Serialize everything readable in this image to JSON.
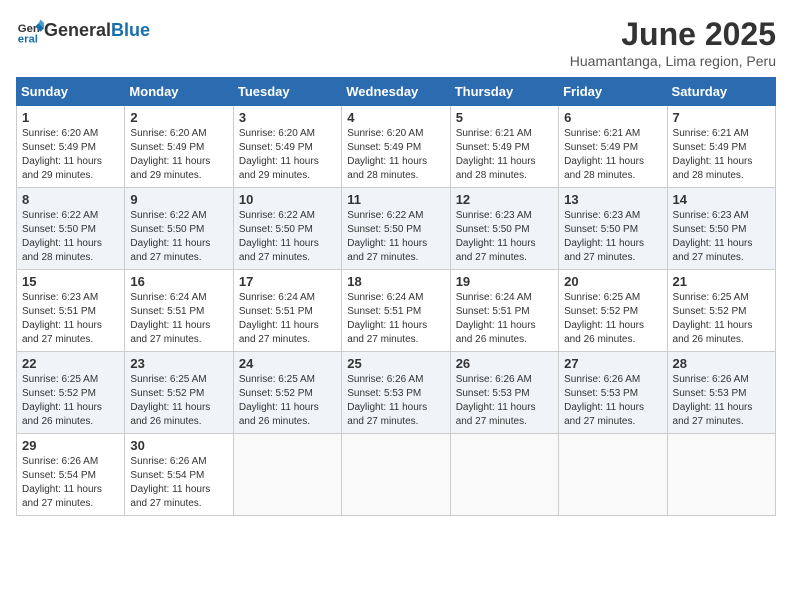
{
  "header": {
    "logo_general": "General",
    "logo_blue": "Blue",
    "title": "June 2025",
    "subtitle": "Huamantanga, Lima region, Peru"
  },
  "calendar": {
    "headers": [
      "Sunday",
      "Monday",
      "Tuesday",
      "Wednesday",
      "Thursday",
      "Friday",
      "Saturday"
    ],
    "weeks": [
      [
        {
          "day": "",
          "sunrise": "",
          "sunset": "",
          "daylight": ""
        },
        {
          "day": "2",
          "sunrise": "Sunrise: 6:20 AM",
          "sunset": "Sunset: 5:49 PM",
          "daylight": "Daylight: 11 hours and 29 minutes."
        },
        {
          "day": "3",
          "sunrise": "Sunrise: 6:20 AM",
          "sunset": "Sunset: 5:49 PM",
          "daylight": "Daylight: 11 hours and 29 minutes."
        },
        {
          "day": "4",
          "sunrise": "Sunrise: 6:20 AM",
          "sunset": "Sunset: 5:49 PM",
          "daylight": "Daylight: 11 hours and 28 minutes."
        },
        {
          "day": "5",
          "sunrise": "Sunrise: 6:21 AM",
          "sunset": "Sunset: 5:49 PM",
          "daylight": "Daylight: 11 hours and 28 minutes."
        },
        {
          "day": "6",
          "sunrise": "Sunrise: 6:21 AM",
          "sunset": "Sunset: 5:49 PM",
          "daylight": "Daylight: 11 hours and 28 minutes."
        },
        {
          "day": "7",
          "sunrise": "Sunrise: 6:21 AM",
          "sunset": "Sunset: 5:49 PM",
          "daylight": "Daylight: 11 hours and 28 minutes."
        }
      ],
      [
        {
          "day": "8",
          "sunrise": "Sunrise: 6:22 AM",
          "sunset": "Sunset: 5:50 PM",
          "daylight": "Daylight: 11 hours and 28 minutes."
        },
        {
          "day": "9",
          "sunrise": "Sunrise: 6:22 AM",
          "sunset": "Sunset: 5:50 PM",
          "daylight": "Daylight: 11 hours and 27 minutes."
        },
        {
          "day": "10",
          "sunrise": "Sunrise: 6:22 AM",
          "sunset": "Sunset: 5:50 PM",
          "daylight": "Daylight: 11 hours and 27 minutes."
        },
        {
          "day": "11",
          "sunrise": "Sunrise: 6:22 AM",
          "sunset": "Sunset: 5:50 PM",
          "daylight": "Daylight: 11 hours and 27 minutes."
        },
        {
          "day": "12",
          "sunrise": "Sunrise: 6:23 AM",
          "sunset": "Sunset: 5:50 PM",
          "daylight": "Daylight: 11 hours and 27 minutes."
        },
        {
          "day": "13",
          "sunrise": "Sunrise: 6:23 AM",
          "sunset": "Sunset: 5:50 PM",
          "daylight": "Daylight: 11 hours and 27 minutes."
        },
        {
          "day": "14",
          "sunrise": "Sunrise: 6:23 AM",
          "sunset": "Sunset: 5:50 PM",
          "daylight": "Daylight: 11 hours and 27 minutes."
        }
      ],
      [
        {
          "day": "15",
          "sunrise": "Sunrise: 6:23 AM",
          "sunset": "Sunset: 5:51 PM",
          "daylight": "Daylight: 11 hours and 27 minutes."
        },
        {
          "day": "16",
          "sunrise": "Sunrise: 6:24 AM",
          "sunset": "Sunset: 5:51 PM",
          "daylight": "Daylight: 11 hours and 27 minutes."
        },
        {
          "day": "17",
          "sunrise": "Sunrise: 6:24 AM",
          "sunset": "Sunset: 5:51 PM",
          "daylight": "Daylight: 11 hours and 27 minutes."
        },
        {
          "day": "18",
          "sunrise": "Sunrise: 6:24 AM",
          "sunset": "Sunset: 5:51 PM",
          "daylight": "Daylight: 11 hours and 27 minutes."
        },
        {
          "day": "19",
          "sunrise": "Sunrise: 6:24 AM",
          "sunset": "Sunset: 5:51 PM",
          "daylight": "Daylight: 11 hours and 26 minutes."
        },
        {
          "day": "20",
          "sunrise": "Sunrise: 6:25 AM",
          "sunset": "Sunset: 5:52 PM",
          "daylight": "Daylight: 11 hours and 26 minutes."
        },
        {
          "day": "21",
          "sunrise": "Sunrise: 6:25 AM",
          "sunset": "Sunset: 5:52 PM",
          "daylight": "Daylight: 11 hours and 26 minutes."
        }
      ],
      [
        {
          "day": "22",
          "sunrise": "Sunrise: 6:25 AM",
          "sunset": "Sunset: 5:52 PM",
          "daylight": "Daylight: 11 hours and 26 minutes."
        },
        {
          "day": "23",
          "sunrise": "Sunrise: 6:25 AM",
          "sunset": "Sunset: 5:52 PM",
          "daylight": "Daylight: 11 hours and 26 minutes."
        },
        {
          "day": "24",
          "sunrise": "Sunrise: 6:25 AM",
          "sunset": "Sunset: 5:52 PM",
          "daylight": "Daylight: 11 hours and 26 minutes."
        },
        {
          "day": "25",
          "sunrise": "Sunrise: 6:26 AM",
          "sunset": "Sunset: 5:53 PM",
          "daylight": "Daylight: 11 hours and 27 minutes."
        },
        {
          "day": "26",
          "sunrise": "Sunrise: 6:26 AM",
          "sunset": "Sunset: 5:53 PM",
          "daylight": "Daylight: 11 hours and 27 minutes."
        },
        {
          "day": "27",
          "sunrise": "Sunrise: 6:26 AM",
          "sunset": "Sunset: 5:53 PM",
          "daylight": "Daylight: 11 hours and 27 minutes."
        },
        {
          "day": "28",
          "sunrise": "Sunrise: 6:26 AM",
          "sunset": "Sunset: 5:53 PM",
          "daylight": "Daylight: 11 hours and 27 minutes."
        }
      ],
      [
        {
          "day": "29",
          "sunrise": "Sunrise: 6:26 AM",
          "sunset": "Sunset: 5:54 PM",
          "daylight": "Daylight: 11 hours and 27 minutes."
        },
        {
          "day": "30",
          "sunrise": "Sunrise: 6:26 AM",
          "sunset": "Sunset: 5:54 PM",
          "daylight": "Daylight: 11 hours and 27 minutes."
        },
        {
          "day": "",
          "sunrise": "",
          "sunset": "",
          "daylight": ""
        },
        {
          "day": "",
          "sunrise": "",
          "sunset": "",
          "daylight": ""
        },
        {
          "day": "",
          "sunrise": "",
          "sunset": "",
          "daylight": ""
        },
        {
          "day": "",
          "sunrise": "",
          "sunset": "",
          "daylight": ""
        },
        {
          "day": "",
          "sunrise": "",
          "sunset": "",
          "daylight": ""
        }
      ]
    ],
    "week1_day1": {
      "day": "1",
      "sunrise": "Sunrise: 6:20 AM",
      "sunset": "Sunset: 5:49 PM",
      "daylight": "Daylight: 11 hours and 29 minutes."
    }
  }
}
